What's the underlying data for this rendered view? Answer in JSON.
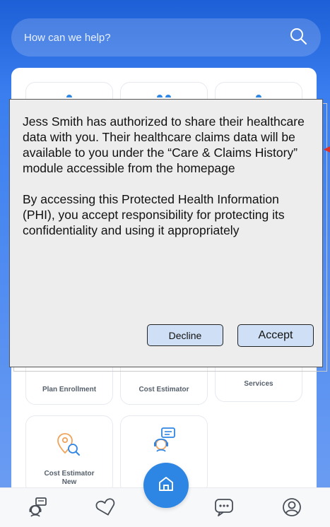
{
  "search": {
    "placeholder": "How can we help?"
  },
  "tiles": {
    "plan_enrollment": "Plan Enrollment",
    "cost_estimator": "Cost Estimator",
    "services": "Services",
    "cost_estimator_new": "Cost Estimator\nNew"
  },
  "dialog": {
    "paragraph1": "Jess Smith has authorized to share their healthcare data with you. Their healthcare claims data will be available to you under the “Care & Claims History” module accessible from the homepage",
    "paragraph2": "By accessing this Protected Health Information (PHI), you accept responsibility for protecting its confidentiality and using it appropriately",
    "decline_label": "Decline",
    "accept_label": "Accept"
  },
  "colors": {
    "brand_blue": "#1d5fd6",
    "accent": "#2e86e4",
    "icon_orange": "#f0a35a",
    "icon_blue": "#2f86e5"
  },
  "nav": {
    "icons": [
      "support-agent-icon",
      "heart-icon",
      "home-icon",
      "chat-icon",
      "profile-icon"
    ]
  }
}
